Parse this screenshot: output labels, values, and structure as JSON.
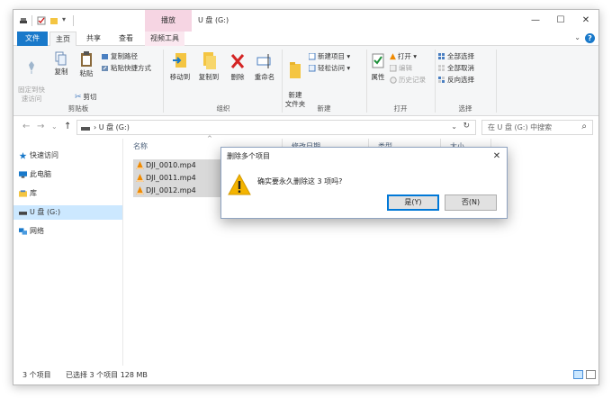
{
  "titlebar": {
    "context_tab_header": "播放",
    "window_title": "U 盘 (G:)",
    "minimize": "—",
    "maximize": "☐",
    "close": "✕"
  },
  "tabs": {
    "file": "文件",
    "home": "主页",
    "share": "共享",
    "view": "查看",
    "video_tools": "视频工具",
    "collapse": "⌄",
    "help": "?"
  },
  "ribbon": {
    "clipboard": {
      "pin_quick_access": "固定到快\n速访问",
      "copy": "复制",
      "paste": "粘贴",
      "copy_path": "复制路径",
      "paste_shortcut": "粘贴快捷方式",
      "cut": "剪切",
      "label": "剪贴板"
    },
    "organize": {
      "move_to": "移动到",
      "copy_to": "复制到",
      "delete": "删除",
      "rename": "重命名",
      "label": "组织"
    },
    "new": {
      "new_folder": "新建\n文件夹",
      "new_item": "新建项目 ▾",
      "easy_access": "轻松访问 ▾",
      "label": "新建"
    },
    "open": {
      "properties": "属性",
      "open": "打开 ▾",
      "edit": "编辑",
      "history": "历史记录",
      "label": "打开"
    },
    "select": {
      "select_all": "全部选择",
      "select_none": "全部取消",
      "invert": "反向选择",
      "label": "选择"
    }
  },
  "address": {
    "back": "←",
    "forward": "→",
    "recent": "⌄",
    "up": "↑",
    "path": "›  U 盘 (G:)",
    "dropdown": "⌄",
    "refresh": "↻",
    "search_placeholder": "在 U 盘 (G:) 中搜索",
    "search_icon": "⌕"
  },
  "navpane": {
    "items": [
      {
        "label": "快速访问",
        "icon": "star-icon"
      },
      {
        "label": "此电脑",
        "icon": "computer-icon"
      },
      {
        "label": "库",
        "icon": "library-icon"
      },
      {
        "label": "U 盘 (G:)",
        "icon": "usb-drive-icon"
      },
      {
        "label": "网络",
        "icon": "network-icon"
      }
    ]
  },
  "columns": {
    "name": "名称",
    "modified": "修改日期",
    "type": "类型",
    "size": "大小",
    "sort_arrow": "^"
  },
  "files": [
    {
      "name": "DJI_0010.mp4"
    },
    {
      "name": "DJI_0011.mp4"
    },
    {
      "name": "DJI_0012.mp4"
    }
  ],
  "status": {
    "count": "3 个项目",
    "selected": "已选择 3 个项目  128 MB"
  },
  "dialog": {
    "title": "删除多个项目",
    "close": "✕",
    "message": "确实要永久删除这 3 项吗?",
    "yes": "是(Y)",
    "no": "否(N)"
  },
  "colors": {
    "accent": "#1979ca",
    "context_tab": "#f6d5e3",
    "selection": "#cce8ff",
    "warning": "#f4b400"
  }
}
